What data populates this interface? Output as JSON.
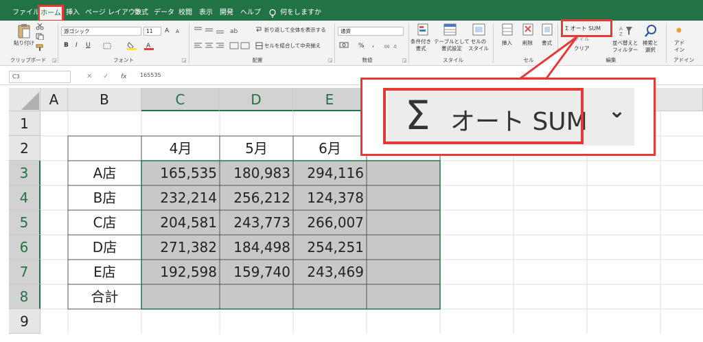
{
  "ribbon_tabs": [
    {
      "label": "ファイル"
    },
    {
      "label": "ホーム"
    },
    {
      "label": "挿入"
    },
    {
      "label": "ページ レイアウト"
    },
    {
      "label": "数式"
    },
    {
      "label": "データ"
    },
    {
      "label": "校閲"
    },
    {
      "label": "表示"
    },
    {
      "label": "開発"
    },
    {
      "label": "ヘルプ"
    },
    {
      "label": "何をしますか"
    }
  ],
  "ribbon": {
    "clipboard": {
      "paste": "貼り付け",
      "group": "クリップボード"
    },
    "font": {
      "name": "游ゴシック",
      "size": "11",
      "grow": "A",
      "shrink": "A",
      "bold": "B",
      "italic": "I",
      "underline": "U",
      "group": "フォント"
    },
    "alignment": {
      "wrap": "折り返して全体を表示する",
      "merge": "セルを結合して中央揃え",
      "group": "配置"
    },
    "number": {
      "format": "通貨",
      "percent": "%",
      "comma": ",",
      "group": "数値"
    },
    "styles": {
      "conditional": "条件付き\n書式",
      "table": "テーブルとして\n書式設定",
      "cell_styles": "セルの\nスタイル",
      "group": "スタイル"
    },
    "cells": {
      "insert": "挿入",
      "delete": "削除",
      "format": "書式",
      "group": "セル"
    },
    "editing": {
      "autosum": "Σ オート SUM",
      "fill": "フィル",
      "clear": "クリア",
      "sort": "並べ替えと\nフィルター",
      "find": "検索と\n選択",
      "group": "編集"
    },
    "addins": {
      "label": "アド\nイン",
      "group": "アドイン"
    }
  },
  "formula_bar": {
    "name_box": "C3",
    "cancel": "✕",
    "enter": "✓",
    "fx": "fx",
    "value": "165535"
  },
  "columns": [
    "A",
    "B",
    "C",
    "D",
    "E"
  ],
  "rows": [
    "1",
    "2",
    "3",
    "4",
    "5",
    "6",
    "7",
    "8",
    "9"
  ],
  "table": {
    "months": [
      "4月",
      "5月",
      "6月"
    ],
    "stores": [
      {
        "name": "A店",
        "values": [
          "165,535",
          "180,983",
          "294,116"
        ]
      },
      {
        "name": "B店",
        "values": [
          "232,214",
          "256,212",
          "124,378"
        ]
      },
      {
        "name": "C店",
        "values": [
          "204,581",
          "243,773",
          "266,007"
        ]
      },
      {
        "name": "D店",
        "values": [
          "271,382",
          "184,498",
          "254,251"
        ]
      },
      {
        "name": "E店",
        "values": [
          "192,598",
          "159,740",
          "243,469"
        ]
      }
    ],
    "total_label": "合計"
  },
  "callout": {
    "sigma": "Σ",
    "text": "オート SUM",
    "chevron": "⌄"
  },
  "colors": {
    "excel_green": "#217346",
    "highlight_red": "#e53935",
    "selection_gray": "#c8c8c8"
  }
}
